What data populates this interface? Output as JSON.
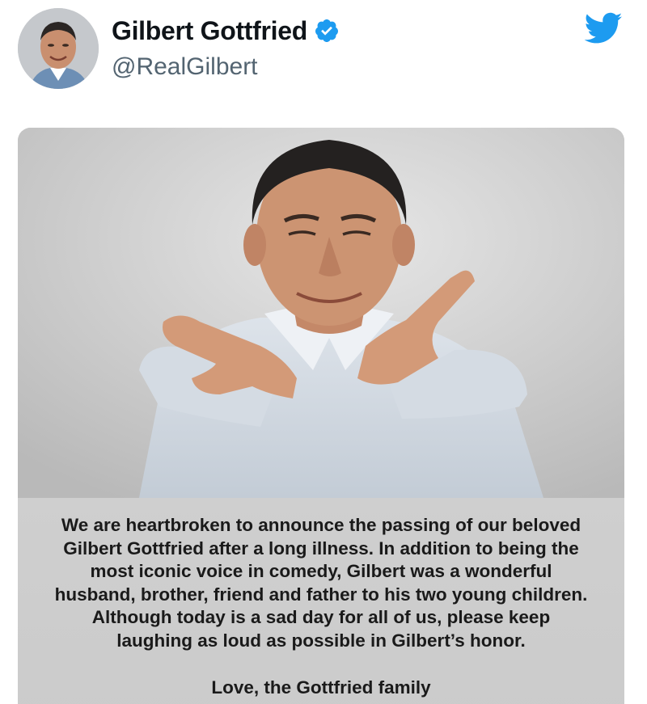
{
  "tweet": {
    "display_name": "Gilbert Gottfried",
    "handle": "@RealGilbert",
    "verified": true,
    "brand_icon": "twitter-bird-icon",
    "colors": {
      "twitter_blue": "#1d9bf0",
      "name_text": "#0f1419",
      "handle_text": "#536471",
      "statement_bg": "#cfcfcf"
    }
  },
  "media": {
    "photo_description_icon": "portrait-photo",
    "statement_lines": [
      "We are heartbroken to announce the passing of our beloved",
      "Gilbert Gottfried after a long illness.  In addition to being the",
      "most iconic voice in comedy, Gilbert was a wonderful",
      "husband, brother, friend and father to his two young children.",
      "Although today is a sad day for all of us, please keep",
      "laughing as loud as possible in Gilbert’s honor."
    ],
    "signoff": "Love, the Gottfried family"
  }
}
